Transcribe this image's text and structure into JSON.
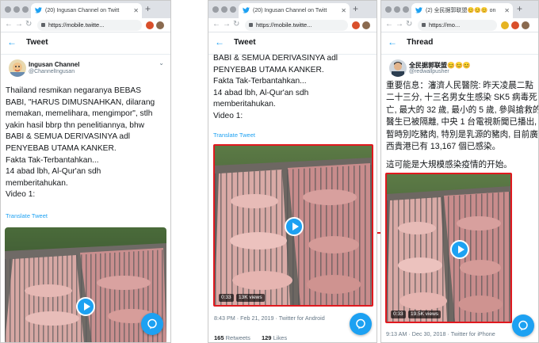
{
  "panels": [
    {
      "tab_title": "(20) Ingusan Channel on Twitt",
      "url": "https://mobile.twitte...",
      "header_title": "Tweet",
      "author": {
        "name": "Ingusan Channel",
        "handle": "@ChannelIngusan"
      },
      "text_lines": [
        "Thailand resmikan negaranya BEBAS",
        "BABI, \"HARUS DIMUSNAHKAN, dilarang",
        "memakan, memelihara, mengimpor\", stlh",
        "yakin hasil bbrp thn penelitiannya, bhw",
        "BABI & SEMUA DERIVASINYA adl",
        "PENYEBAB UTAMA KANKER.",
        "Fakta Tak-Terbantahkan...",
        "14 abad lbh, Al-Qur'an sdh",
        "memberitahukan.",
        "Video 1:"
      ],
      "translate": "Translate Tweet"
    },
    {
      "tab_title": "(20) Ingusan Channel on Twitt",
      "url": "https://mobile.twitte...",
      "header_title": "Tweet",
      "text_lines": [
        "BABI & SEMUA DERIVASINYA adl",
        "PENYEBAB UTAMA KANKER.",
        "Fakta Tak-Terbantahkan...",
        "14 abad lbh, Al-Qur'an sdh",
        "memberitahukan.",
        "Video 1:"
      ],
      "translate": "Translate Tweet",
      "video_duration": "0:33",
      "video_views": "13K views",
      "meta": "8:43 PM · Feb 21, 2019 · Twitter for Android",
      "retweets_count": "165",
      "retweets_label": "Retweets",
      "likes_count": "129",
      "likes_label": "Likes"
    },
    {
      "tab_title": "(2) 全民据郭联盟😊😊😊 on",
      "url": "https://mo...",
      "header_title": "Thread",
      "author": {
        "name": "全民据郭联盟😊😊😊",
        "handle": "@redwallpusher"
      },
      "text_lines": [
        "重要信息：瀋濟人民醫院: 昨天凌晨二點",
        "二十三分, 十三名男女生感染 SK5 病毒死",
        "亡, 最大的 32 歲, 最小的 5 歲, 參與搶救的",
        "醫生已被隔離, 中央 1 台電視新聞已播出,",
        "暫時別吃豬肉, 特別是乳源的豬肉, 目前廣",
        "西貴港已有 13,167 個已感染。",
        "",
        "這可能是大規模感染疫情的开始。"
      ],
      "video_duration": "0:33",
      "video_views": "19.5K views",
      "meta": "9:13 AM · Dec 30, 2018 · Twitter for iPhone"
    }
  ],
  "colors": {
    "twitter_blue": "#1da1f2",
    "highlight_red": "#e0191f"
  }
}
